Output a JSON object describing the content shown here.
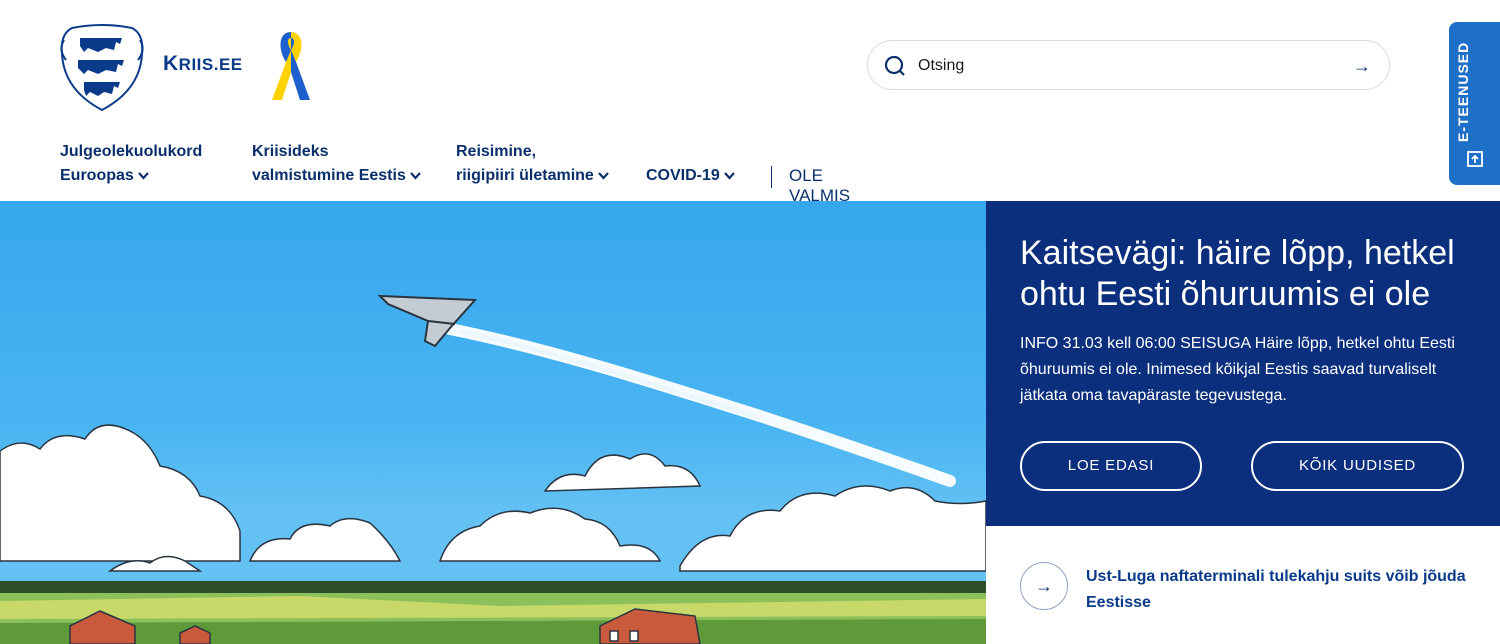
{
  "header": {
    "brand_prefix": "K",
    "brand_rest": "RIIS.EE",
    "search": {
      "placeholder": "Otsing"
    },
    "eteenused": "E-TEENUSED"
  },
  "nav": {
    "items": [
      {
        "line1": "Julgeolekuolukord",
        "line2": "Euroopas"
      },
      {
        "line1": "Kriisideks",
        "line2": "valmistumine Eestis"
      },
      {
        "line1": "Reisimine,",
        "line2": "riigipiiri ületamine"
      },
      {
        "line1": "",
        "line2": "COVID-19"
      }
    ],
    "plain_item": "OLE VALMIS"
  },
  "hero": {
    "title": "Kaitsevägi: häire lõpp, hetkel ohtu Eesti õhuruumis ei ole",
    "body": "INFO 31.03 kell 06:00 SEISUGA Häire lõpp, hetkel ohtu Eesti õhuruumis ei ole. Inimesed kõikjal Eestis saavad turvaliselt jätkata oma tavapäraste tegevustega.",
    "read_more": "LOE EDASI",
    "all_news": "KÕIK UUDISED"
  },
  "news": [
    {
      "title": "Ust-Luga naftaterminali tulekahju suits võib jõuda Eestisse"
    }
  ],
  "colors": {
    "primary": "#0b2f7d",
    "accent": "#1d6fc7",
    "sky": "#49b4f2"
  }
}
